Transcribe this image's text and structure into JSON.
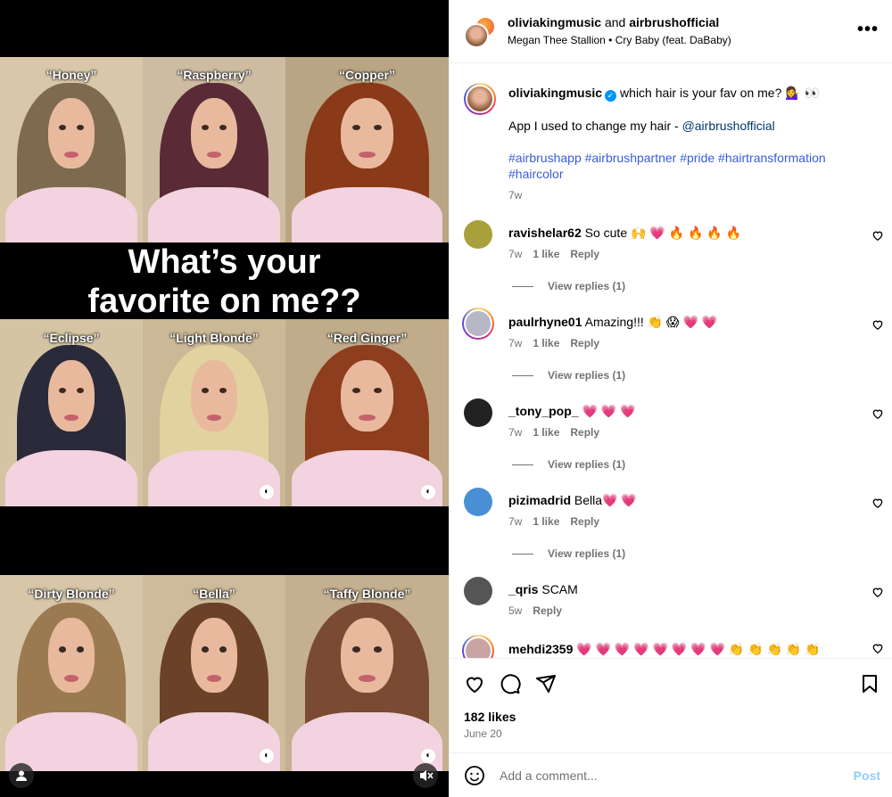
{
  "media": {
    "headline_line1": "What’s your",
    "headline_line2": "favorite on me??",
    "tiles": [
      {
        "caption": "“Honey”",
        "hair": "#7d6a4f",
        "wall": "#d9c7a9"
      },
      {
        "caption": "“Raspberry”",
        "hair": "#5a2a36",
        "wall": "#cdbca2"
      },
      {
        "caption": "“Copper”",
        "hair": "#8a3a18",
        "wall": "#b9a584"
      },
      {
        "caption": "“Eclipse”",
        "hair": "#2a2a3a",
        "wall": "#d5c4a4"
      },
      {
        "caption": "“Light Blonde”",
        "hair": "#e2d2a0",
        "wall": "#cbb896"
      },
      {
        "caption": "“Red Ginger”",
        "hair": "#8e3d1e",
        "wall": "#c0ab8a"
      },
      {
        "caption": "“Dirty Blonde”",
        "hair": "#9b7a52",
        "wall": "#d7c6a8"
      },
      {
        "caption": "“Bella”",
        "hair": "#6b4127",
        "wall": "#cdbb9b"
      },
      {
        "caption": "“Taffy Blonde”",
        "hair": "#7a4a32",
        "wall": "#c4b090"
      }
    ]
  },
  "header": {
    "user1": "oliviakingmusic",
    "and": "and",
    "user2": "airbrushofficial",
    "music": "Megan Thee Stallion • Cry Baby (feat. DaBaby)",
    "more": "•••"
  },
  "caption": {
    "username": "oliviakingmusic",
    "text": "which hair is your fav on me? 💁‍♀️ 👀",
    "line2_prefix": "App I used to change my hair - ",
    "line2_link": "@airbrushofficial",
    "hashtags": "#airbrushapp #airbrushpartner #pride #hairtransformation #haircolor",
    "time": "7w"
  },
  "comments": [
    {
      "user": "ravishelar62",
      "text": "So cute 🙌 💗 🔥 🔥 🔥 🔥",
      "time": "7w",
      "likes": "1 like",
      "reply": "Reply",
      "view_replies": "View replies (1)",
      "avatar_color": "#a8a03a"
    },
    {
      "user": "paulrhyne01",
      "text": "Amazing!!! 👏 😱 💗 💗",
      "time": "7w",
      "likes": "1 like",
      "reply": "Reply",
      "view_replies": "View replies (1)",
      "avatar_color": "#b7b7c7"
    },
    {
      "user": "_tony_pop_",
      "text": "💗 💗 💗",
      "time": "7w",
      "likes": "1 like",
      "reply": "Reply",
      "view_replies": "View replies (1)",
      "avatar_color": "#222"
    },
    {
      "user": "pizimadrid",
      "text": "Bella💗 💗",
      "time": "7w",
      "likes": "1 like",
      "reply": "Reply",
      "view_replies": "View replies (1)",
      "avatar_color": "#4a8fd6"
    },
    {
      "user": "_qris",
      "text": "SCAM",
      "time": "5w",
      "likes": "",
      "reply": "Reply",
      "view_replies": "",
      "avatar_color": "#555"
    },
    {
      "user": "mehdi2359",
      "text": "💗 💗 💗 💗 💗 💗 💗 💗 👏 👏 👏 👏 👏",
      "time": "",
      "likes": "",
      "reply": "",
      "view_replies": "",
      "avatar_color": "#c9a4a4"
    }
  ],
  "footer": {
    "likes": "182 likes",
    "date": "June 20",
    "add_comment_placeholder": "Add a comment...",
    "post_label": "Post"
  },
  "colors": {
    "link": "#00376b",
    "hashtag": "#3b5bdb",
    "verified": "#0095f6",
    "post_button": "#0095f6"
  }
}
